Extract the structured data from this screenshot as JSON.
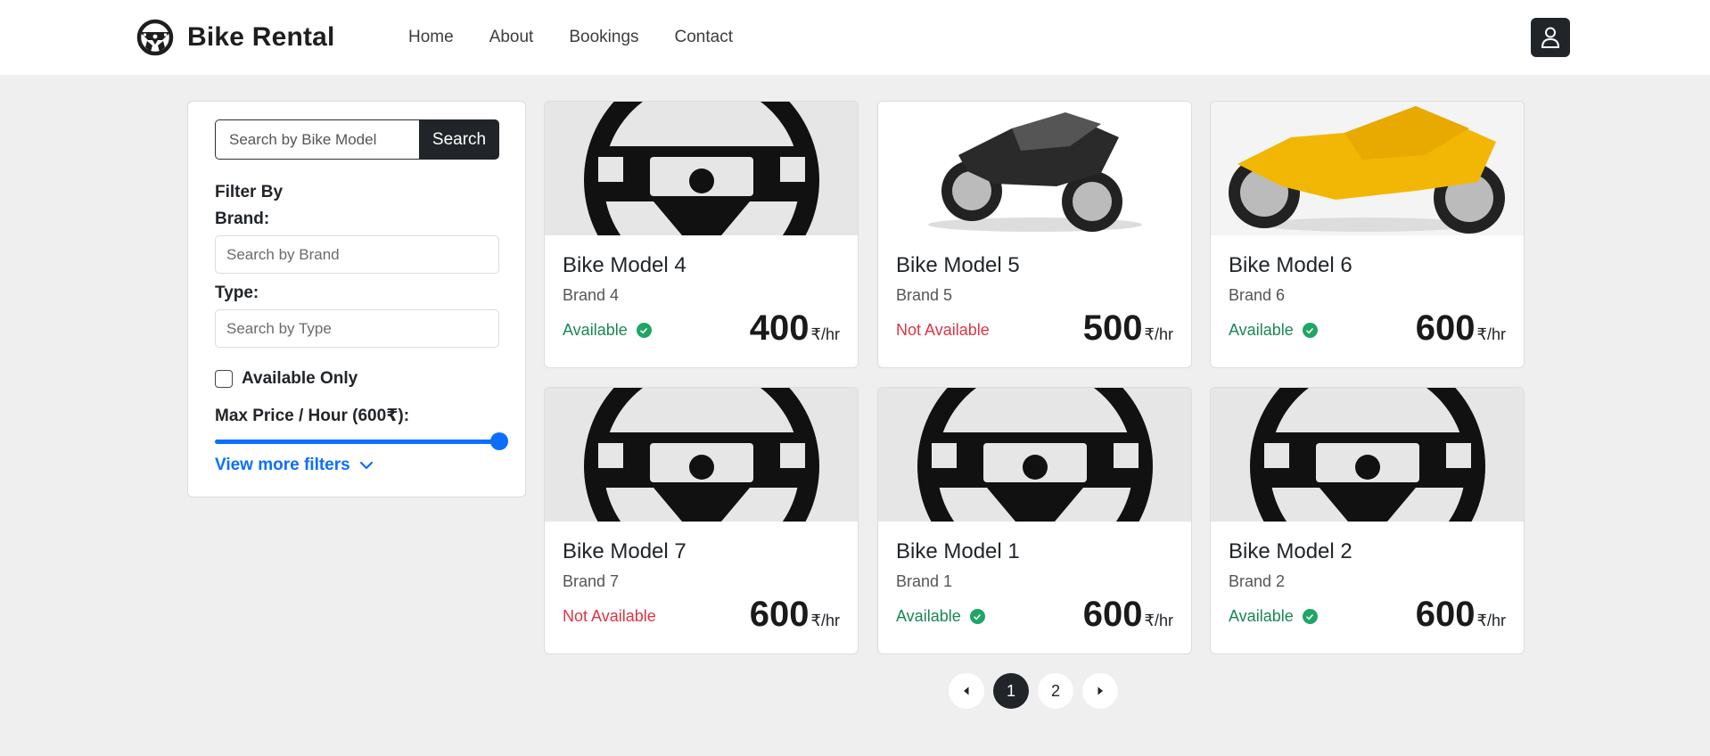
{
  "app": {
    "title": "Bike Rental"
  },
  "nav": {
    "items": [
      "Home",
      "About",
      "Bookings",
      "Contact"
    ]
  },
  "filters": {
    "search_placeholder": "Search by Bike Model",
    "search_button": "Search",
    "filter_by": "Filter By",
    "brand_label": "Brand:",
    "brand_placeholder": "Search by Brand",
    "type_label": "Type:",
    "type_placeholder": "Search by Type",
    "available_only": "Available Only",
    "available_checked": false,
    "max_price_label": "Max Price / Hour (600₹):",
    "max_price_fraction": 1.0,
    "view_more": "View more filters"
  },
  "bikes": [
    {
      "title": "Bike Model 4",
      "brand": "Brand 4",
      "status": "Available",
      "available": true,
      "price": "400",
      "unit": "₹/hr",
      "image": "steering-wheel-placeholder"
    },
    {
      "title": "Bike Model 5",
      "brand": "Brand 5",
      "status": "Not Available",
      "available": false,
      "price": "500",
      "unit": "₹/hr",
      "image": "black-sport-bike-photo"
    },
    {
      "title": "Bike Model 6",
      "brand": "Brand 6",
      "status": "Available",
      "available": true,
      "price": "600",
      "unit": "₹/hr",
      "image": "yellow-sport-bike-photo"
    },
    {
      "title": "Bike Model 7",
      "brand": "Brand 7",
      "status": "Not Available",
      "available": false,
      "price": "600",
      "unit": "₹/hr",
      "image": "steering-wheel-placeholder"
    },
    {
      "title": "Bike Model 1",
      "brand": "Brand 1",
      "status": "Available",
      "available": true,
      "price": "600",
      "unit": "₹/hr",
      "image": "steering-wheel-placeholder"
    },
    {
      "title": "Bike Model 2",
      "brand": "Brand 2",
      "status": "Available",
      "available": true,
      "price": "600",
      "unit": "₹/hr",
      "image": "steering-wheel-placeholder"
    }
  ],
  "pagination": {
    "pages": [
      "1",
      "2"
    ],
    "current": "1"
  },
  "colors": {
    "accent": "#0d6efd",
    "dark": "#212529",
    "available": "#198754",
    "unavailable": "#dc3545",
    "page_bg": "#efefef"
  }
}
